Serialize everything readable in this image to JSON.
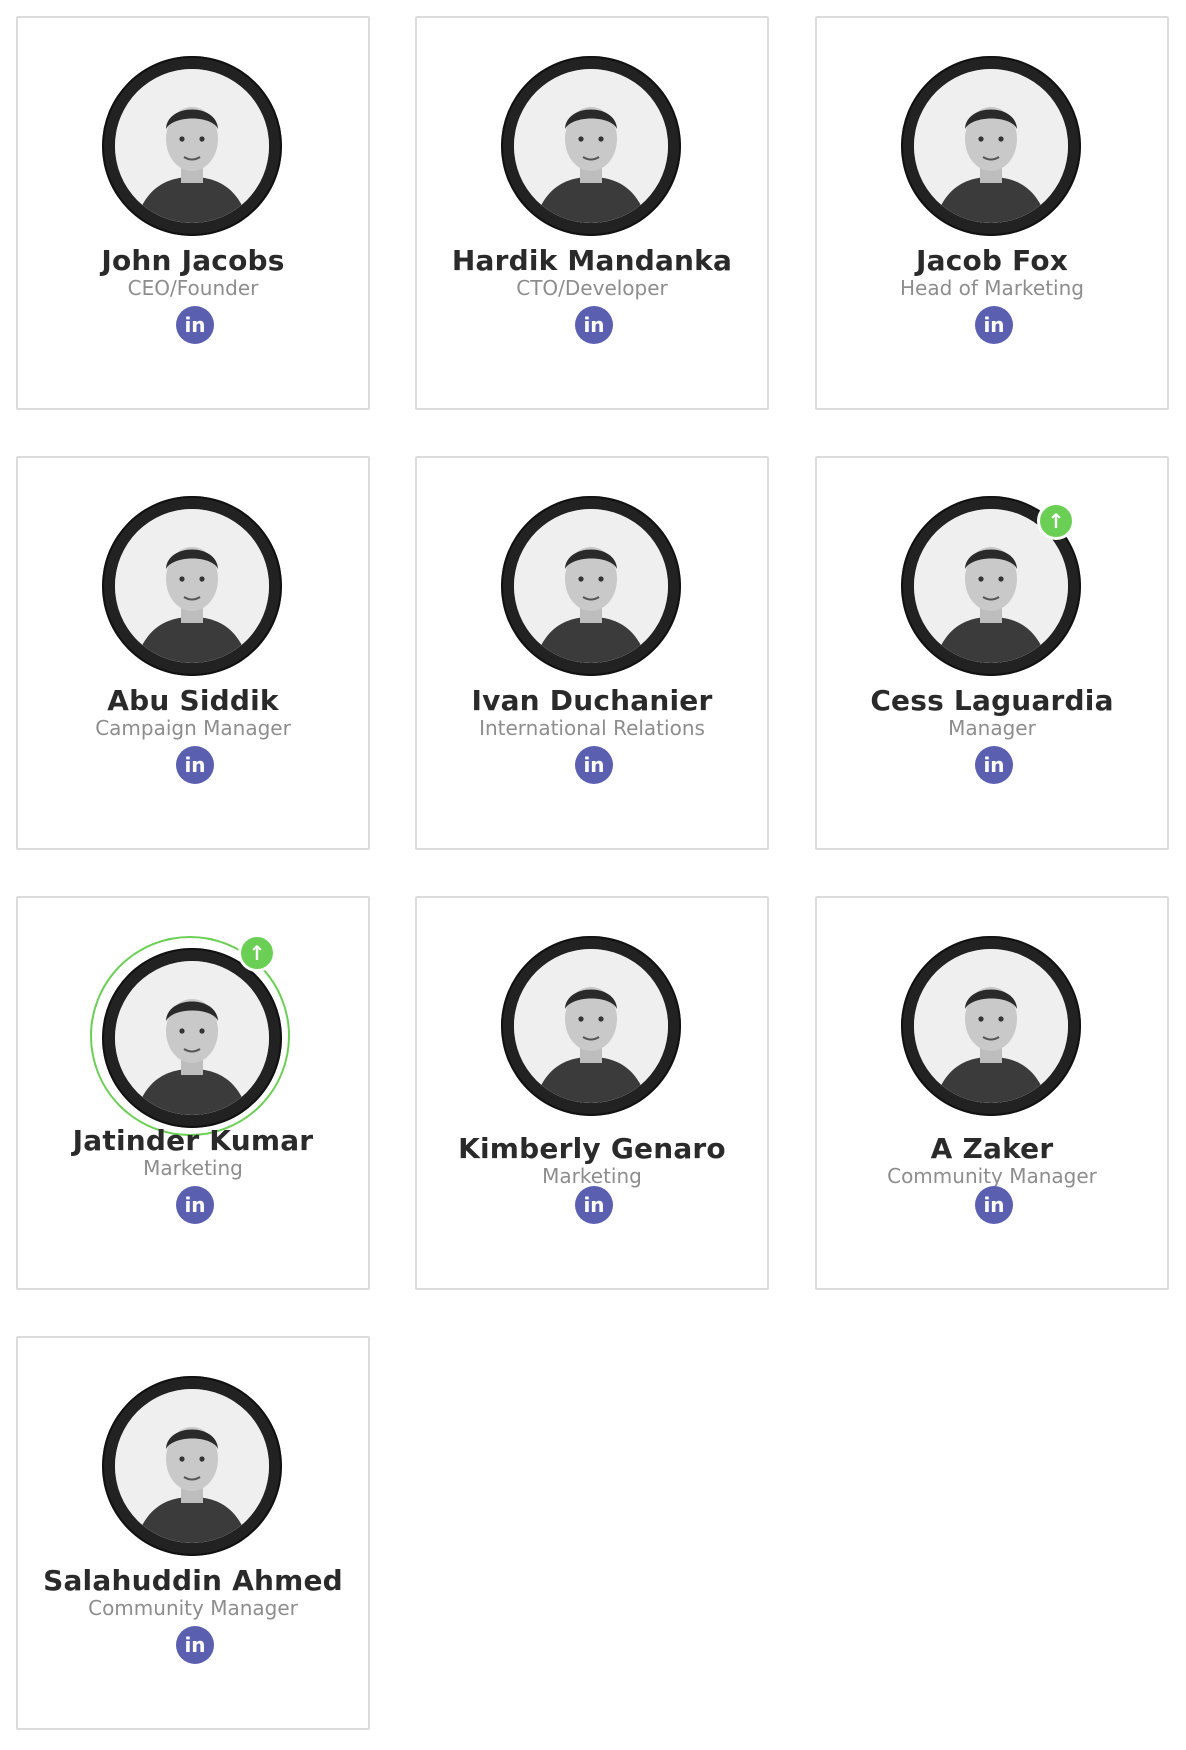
{
  "team": {
    "members": [
      {
        "name": "John Jacobs",
        "role": "CEO/Founder",
        "social": "linkedin-icon",
        "promoted": false,
        "ring": false
      },
      {
        "name": "Hardik Mandanka",
        "role": "CTO/Developer",
        "social": "linkedin-icon",
        "promoted": false,
        "ring": false
      },
      {
        "name": "Jacob Fox",
        "role": "Head of Marketing",
        "social": "linkedin-icon",
        "promoted": false,
        "ring": false
      },
      {
        "name": "Abu Siddik",
        "role": "Campaign Manager",
        "social": "linkedin-icon",
        "promoted": false,
        "ring": false
      },
      {
        "name": "Ivan Duchanier",
        "role": "International Relations",
        "social": "linkedin-icon",
        "promoted": false,
        "ring": false
      },
      {
        "name": "Cess Laguardia",
        "role": "Manager",
        "social": "linkedin-icon",
        "promoted": true,
        "ring": false
      },
      {
        "name": "Jatinder Kumar",
        "role": "Marketing",
        "social": "linkedin-icon",
        "promoted": true,
        "ring": true
      },
      {
        "name": "Kimberly Genaro",
        "role": "Marketing",
        "social": "linkedin-icon",
        "promoted": false,
        "ring": false
      },
      {
        "name": "A Zaker",
        "role": "Community Manager",
        "social": "linkedin-icon",
        "promoted": false,
        "ring": false
      },
      {
        "name": "Salahuddin Ahmed",
        "role": "Community Manager",
        "social": "linkedin-icon",
        "promoted": false,
        "ring": false
      }
    ],
    "linkedin_glyph": "in",
    "promoted_glyph": "↑",
    "colors": {
      "linkedin": "#5a5fb0",
      "promoted": "#6ccf55",
      "avatar_ring": "#222222"
    }
  }
}
